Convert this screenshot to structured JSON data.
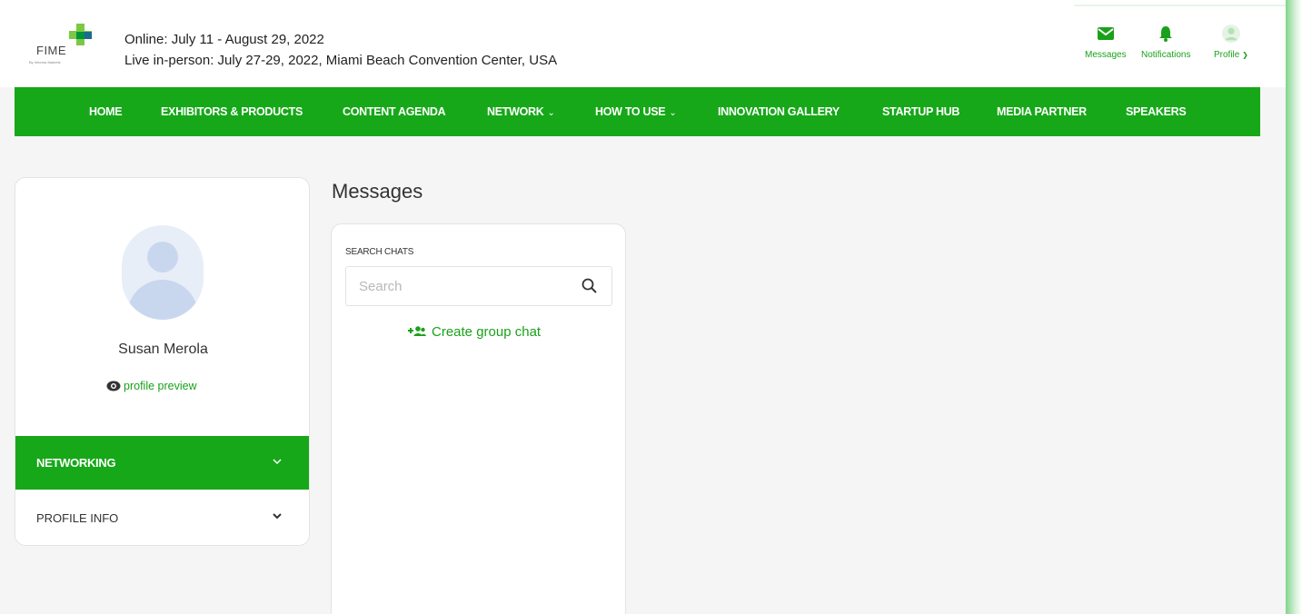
{
  "header": {
    "logo_text": "FIME",
    "logo_subtext": "By Informa Markets",
    "online_dates": "Online: July 11 - August 29, 2022",
    "live_dates": "Live in-person: July 27-29, 2022, Miami Beach Convention Center, USA",
    "actions": {
      "messages": "Messages",
      "notifications": "Notifications",
      "profile": "Profile"
    }
  },
  "nav": {
    "items": [
      {
        "label": "HOME"
      },
      {
        "label": "EXHIBITORS & PRODUCTS"
      },
      {
        "label": "CONTENT AGENDA"
      },
      {
        "label": "NETWORK"
      },
      {
        "label": "HOW TO USE"
      },
      {
        "label": "INNOVATION GALLERY"
      },
      {
        "label": "STARTUP HUB"
      },
      {
        "label": "MEDIA PARTNER"
      },
      {
        "label": "SPEAKERS"
      }
    ]
  },
  "sidebar": {
    "user_name": "Susan Merola",
    "profile_preview": "profile preview",
    "sections": [
      {
        "label": "NETWORKING"
      },
      {
        "label": "PROFILE INFO"
      }
    ]
  },
  "messages": {
    "title": "Messages",
    "search_label": "SEARCH CHATS",
    "search_placeholder": "Search",
    "create_group": "Create group chat"
  },
  "colors": {
    "brand_green": "#16a818",
    "accent_green_text": "#1aa11a"
  },
  "icons": {
    "messages": "envelope-icon",
    "notifications": "bell-icon",
    "profile": "user-avatar-icon",
    "search": "magnifier-icon",
    "group": "add-group-icon",
    "preview": "eye-icon"
  }
}
